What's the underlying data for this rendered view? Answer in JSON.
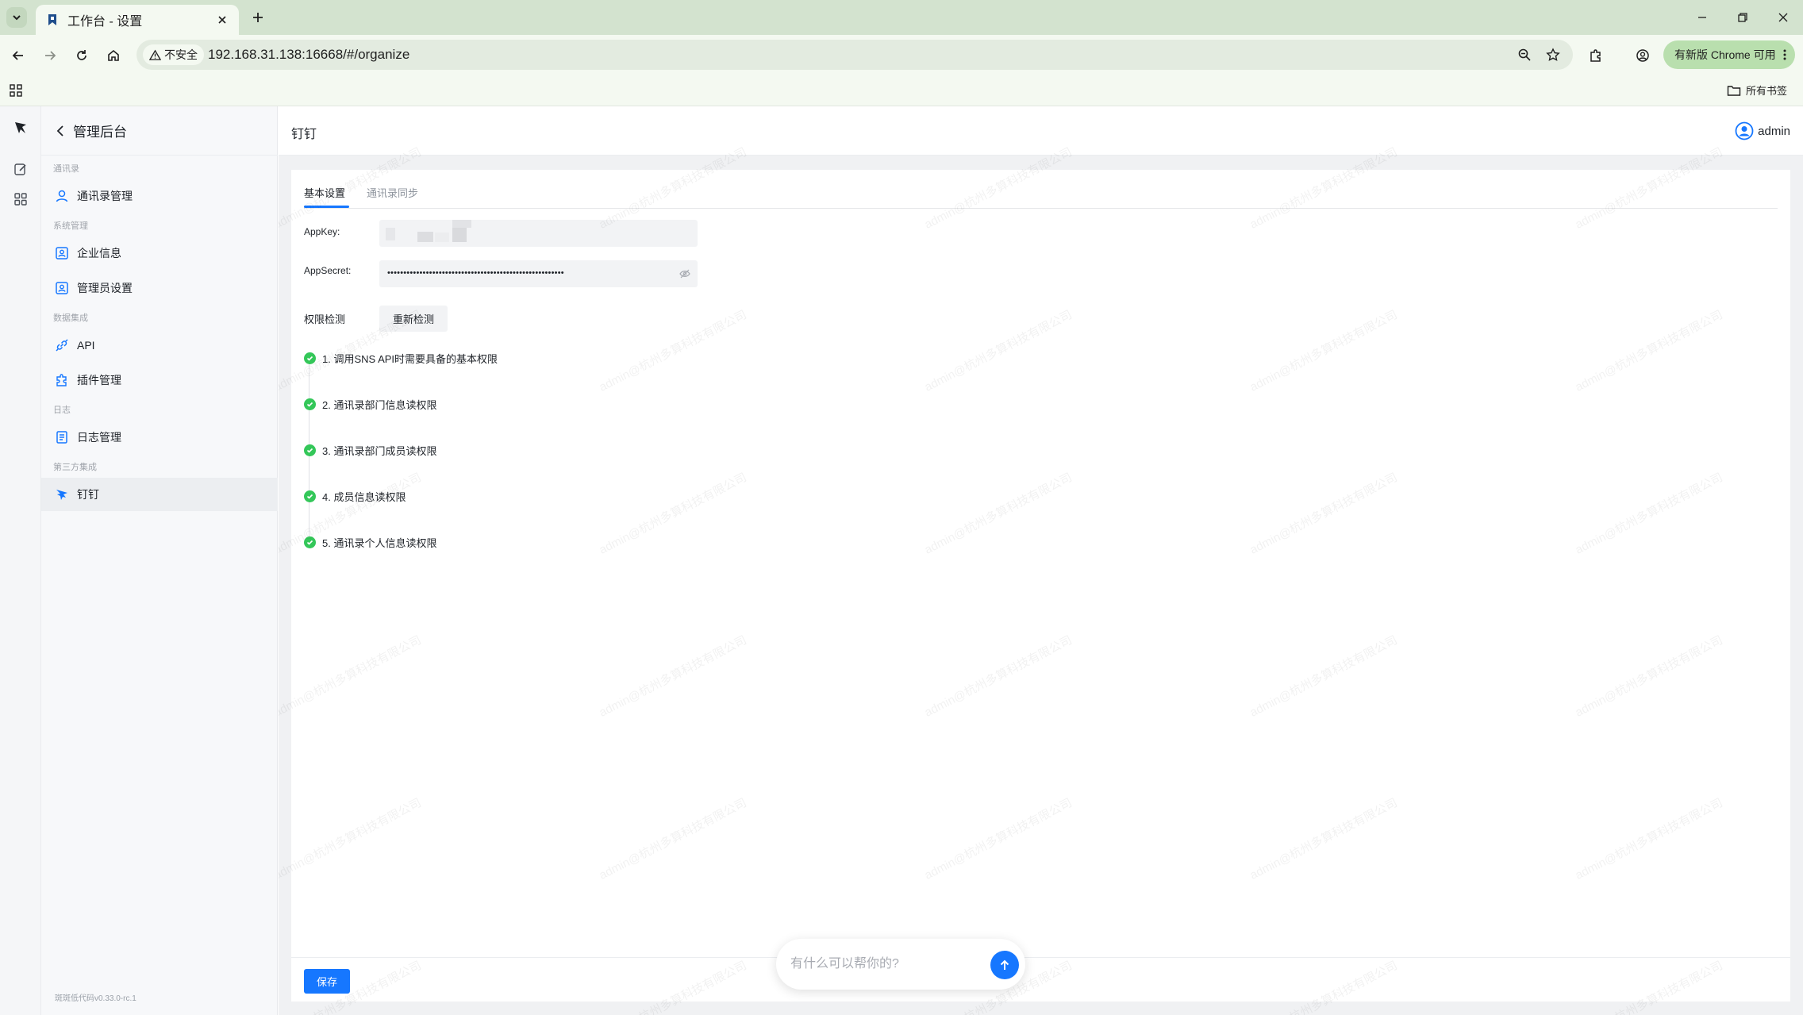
{
  "browser": {
    "tab_title": "工作台 - 设置",
    "security_label": "不安全",
    "url": "192.168.31.138:16668/#/organize",
    "update_label": "有新版 Chrome 可用",
    "bookmarks_label": "所有书签"
  },
  "sidebar": {
    "back_title": "管理后台",
    "groups": [
      {
        "title": "通讯录",
        "items": [
          {
            "label": "通讯录管理",
            "icon": "user-icon"
          }
        ]
      },
      {
        "title": "系统管理",
        "items": [
          {
            "label": "企业信息",
            "icon": "company-info-icon"
          },
          {
            "label": "管理员设置",
            "icon": "admin-settings-icon"
          }
        ]
      },
      {
        "title": "数据集成",
        "items": [
          {
            "label": "API",
            "icon": "api-link-icon"
          },
          {
            "label": "插件管理",
            "icon": "plugin-icon"
          }
        ]
      },
      {
        "title": "日志",
        "items": [
          {
            "label": "日志管理",
            "icon": "log-icon"
          }
        ]
      },
      {
        "title": "第三方集成",
        "items": [
          {
            "label": "钉钉",
            "icon": "dingtalk-icon",
            "active": true
          }
        ]
      }
    ],
    "footer": "斑斑低代码v0.33.0-rc.1"
  },
  "header": {
    "page_title": "钉钉",
    "user": "admin"
  },
  "content": {
    "tabs": [
      "基本设置",
      "通讯录同步"
    ],
    "active_tab": "基本设置",
    "fields": {
      "appkey_label": "AppKey:",
      "appsecret_label": "AppSecret:",
      "appsecret_value": "•••••••••••••••••••••••••••••••••••••••••••••••••••••••",
      "permission_label": "权限检测",
      "redetect_label": "重新检测"
    },
    "checks": [
      "1. 调用SNS API时需要具备的基本权限",
      "2. 通讯录部门信息读权限",
      "3. 通讯录部门成员读权限",
      "4. 成员信息读权限",
      "5. 通讯录个人信息读权限"
    ],
    "check_status": "passed",
    "save_label": "保存"
  },
  "assistant": {
    "placeholder": "有什么可以帮你的?"
  },
  "watermark_text": "admin@杭州多算科技有限公司",
  "colors": {
    "primary": "#1677ff",
    "success": "#34c759",
    "browser_frame": "#d3e3cf"
  }
}
